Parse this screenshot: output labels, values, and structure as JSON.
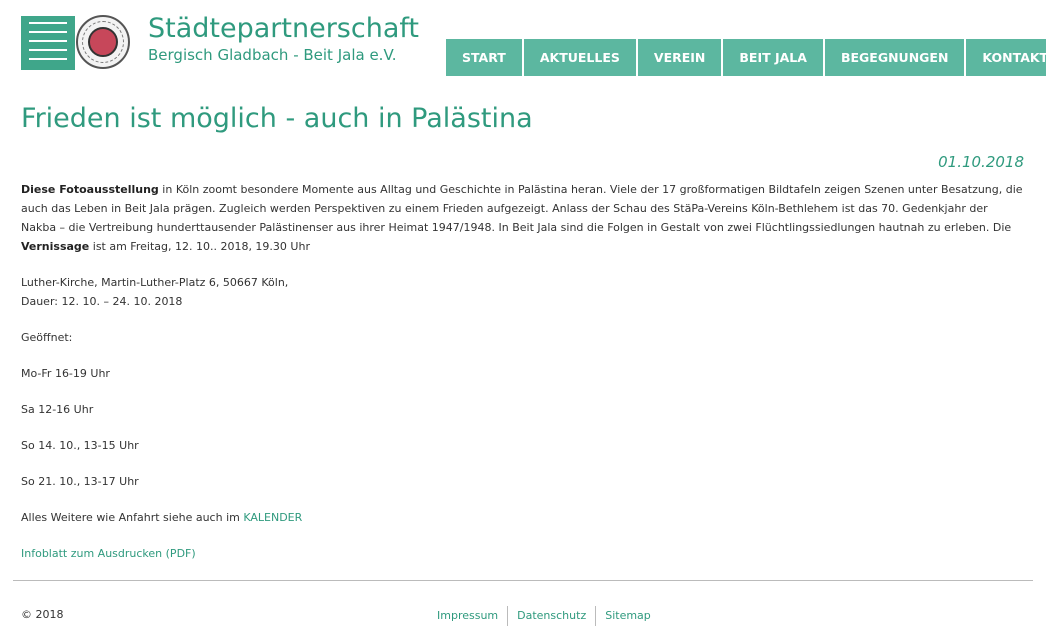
{
  "header": {
    "title": "Städtepartnerschaft",
    "subtitle": "Bergisch Gladbach - Beit Jala e.V.",
    "colors": {
      "brand": "#2f9a7e",
      "nav_bg": "#5cb7a0"
    }
  },
  "nav": {
    "items": [
      {
        "label": "START"
      },
      {
        "label": "AKTUELLES"
      },
      {
        "label": "VEREIN"
      },
      {
        "label": "BEIT JALA"
      },
      {
        "label": "BEGEGNUNGEN"
      },
      {
        "label": "KONTAKT"
      }
    ]
  },
  "article": {
    "title": "Frieden ist möglich - auch in Palästina",
    "date": "01.10.2018",
    "intro_bold": "Diese Fotoausstellung",
    "intro_text": " in Köln zoomt besondere Momente aus Alltag und Geschichte in Palästina heran. Viele der 17 großformatigen Bildtafeln zeigen Szenen unter Besatzung, die auch das Leben in Beit Jala prägen. Zugleich werden Perspektiven zu einem Frieden aufgezeigt. Anlass der Schau des StäPa-Vereins Köln-Bethlehem ist das 70. Gedenkjahr der Nakba – die Vertreibung hunderttausender Palästinenser aus ihrer Heimat 1947/1948. In Beit Jala sind die Folgen in Gestalt von zwei Flüchtlingssiedlungen hautnah zu erleben. Die ",
    "vernissage_bold": "Vernissage",
    "vernissage_text": " ist am Freitag, 12. 10.. 2018, 19.30 Uhr",
    "location": "Luther-Kirche, Martin-Luther-Platz 6, 50667 Köln,",
    "duration": "Dauer: 12. 10. – 24. 10. 2018",
    "opened_label": "Geöffnet:",
    "hours": [
      "Mo-Fr 16-19 Uhr",
      "Sa 12-16 Uhr",
      "So 14. 10., 13-15 Uhr",
      "So 21. 10., 13-17 Uhr"
    ],
    "more_text": "Alles Weitere wie Anfahrt siehe auch im ",
    "calendar_link": "KALENDER",
    "pdf_link": "Infoblatt zum Ausdrucken (PDF)"
  },
  "footer": {
    "copyright": "© 2018",
    "links": [
      {
        "label": "Impressum"
      },
      {
        "label": "Datenschutz"
      },
      {
        "label": "Sitemap"
      }
    ]
  }
}
